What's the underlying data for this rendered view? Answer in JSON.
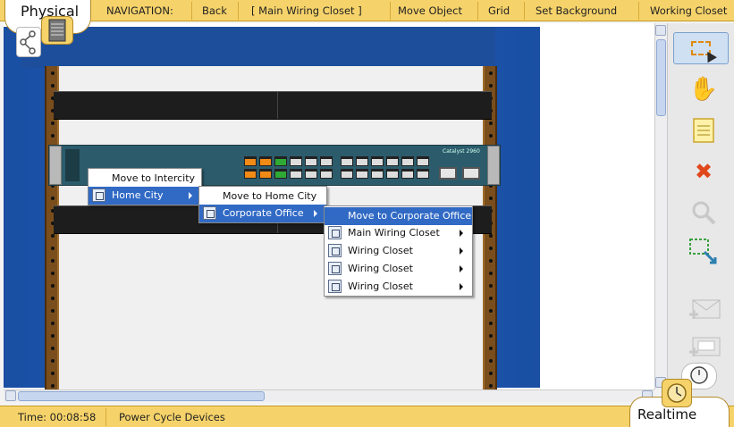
{
  "topbar": {
    "mode_label": "Physical",
    "navigation_label": "NAVIGATION:",
    "back_label": "Back",
    "current_location": "[ Main Wiring Closet ]",
    "move_object_label": "Move Object",
    "grid_label": "Grid",
    "set_background_label": "Set Background",
    "working_closet_label": "Working Closet"
  },
  "rack": {
    "switch_model": "Catalyst 2960"
  },
  "context_menu": {
    "level1": [
      {
        "label": "Move to Intercity"
      },
      {
        "label": "Home City"
      }
    ],
    "level2": [
      {
        "label": "Move to Home City"
      },
      {
        "label": "Corporate Office"
      }
    ],
    "level3": [
      {
        "label": "Move to Corporate Office"
      },
      {
        "label": "Main Wiring Closet"
      },
      {
        "label": "Wiring Closet"
      },
      {
        "label": "Wiring Closet"
      },
      {
        "label": "Wiring Closet"
      }
    ]
  },
  "toolbar": {
    "tools": [
      "select-icon",
      "hand-icon",
      "note-icon",
      "delete-icon",
      "inspect-icon",
      "resize-icon",
      "add-simple-pdu-icon",
      "add-complex-pdu-icon"
    ]
  },
  "bottombar": {
    "time": "Time: 00:08:58",
    "power_cycle_label": "Power Cycle Devices",
    "mode_label": "Realtime"
  },
  "colors": {
    "bar_yellow": "#f6d36a",
    "menu_highlight": "#316ac5",
    "background_blue": "#1f5bb6"
  }
}
